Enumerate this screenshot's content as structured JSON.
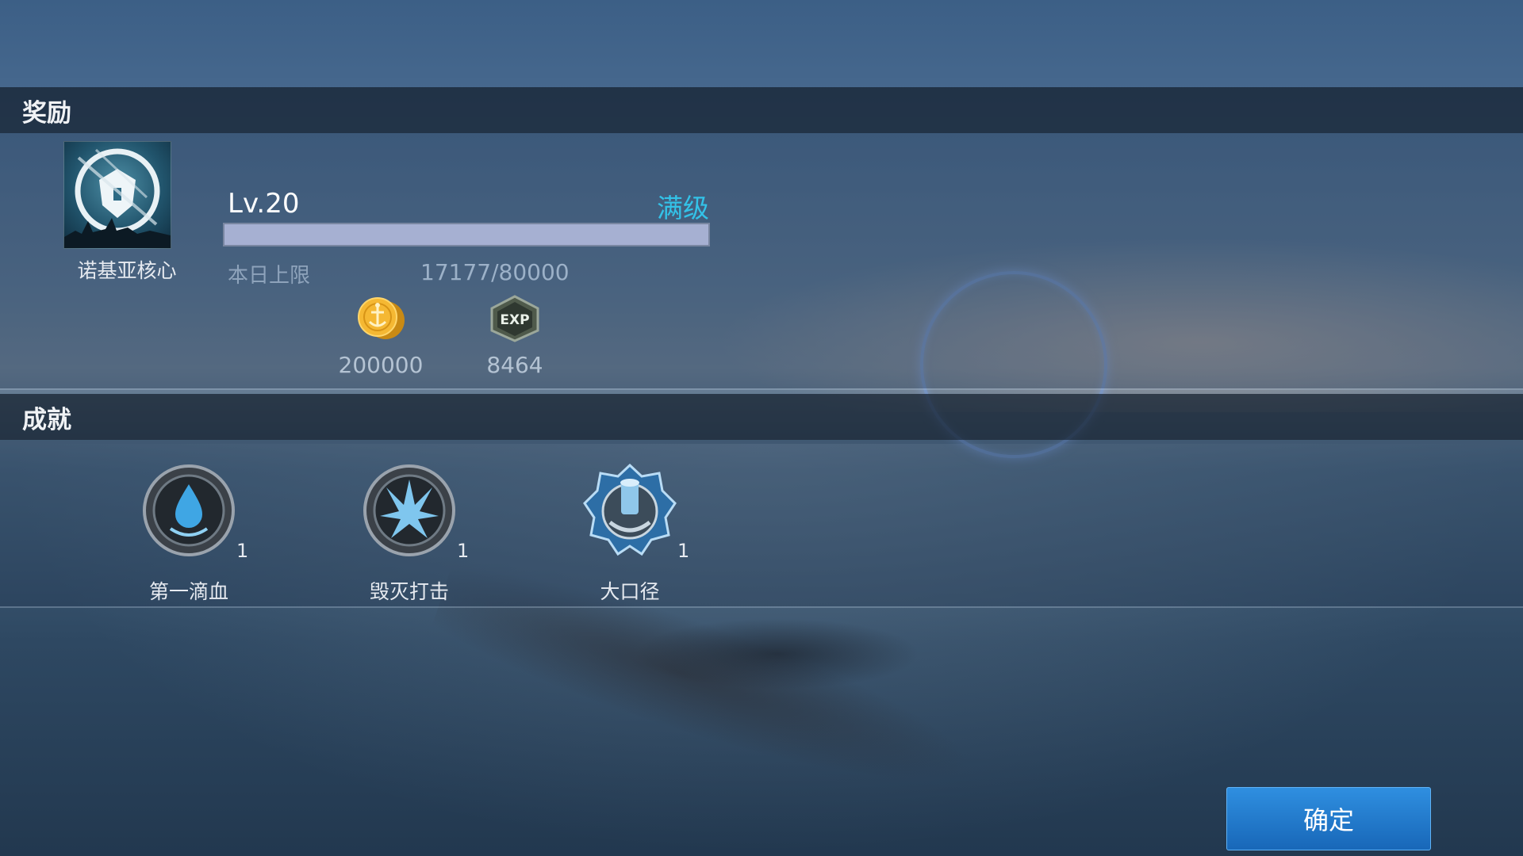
{
  "reward_section": {
    "title": "奖励"
  },
  "ship": {
    "name": "诺基亚核心"
  },
  "level": {
    "label": "Lv.20",
    "status": "满级",
    "progress": 1.0
  },
  "daily_limit": {
    "label": "本日上限",
    "value": "17177/80000"
  },
  "rewards": [
    {
      "icon": "gold-anchor-coin-icon",
      "value": "200000"
    },
    {
      "icon": "exp-hexagon-icon",
      "value": "8464",
      "icon_text": "EXP"
    }
  ],
  "achievement_section": {
    "title": "成就"
  },
  "achievements": [
    {
      "name": "第一滴血",
      "count": "1",
      "icon": "blood-drop-medal-icon"
    },
    {
      "name": "毁灭打击",
      "count": "1",
      "icon": "explosion-medal-icon"
    },
    {
      "name": "大口径",
      "count": "1",
      "icon": "cannon-medal-icon"
    }
  ],
  "confirm_button": {
    "label": "确定"
  },
  "colors": {
    "accent_cyan": "#33c2e8",
    "button_blue": "#1f7fd6",
    "gold": "#f2b632"
  }
}
